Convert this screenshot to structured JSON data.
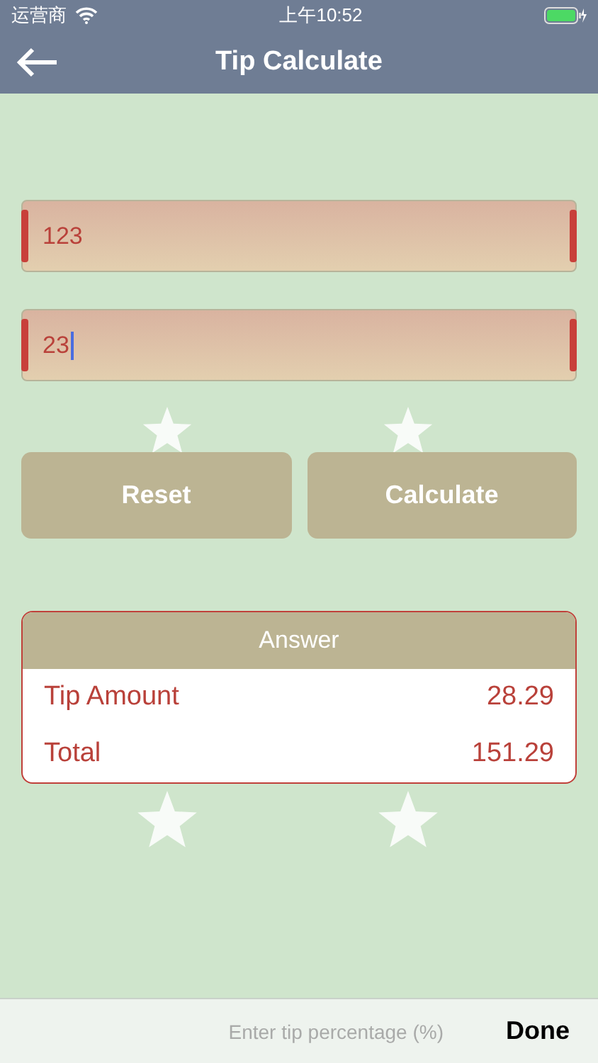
{
  "status_bar": {
    "carrier": "运营商",
    "time": "上午10:52"
  },
  "nav": {
    "title": "Tip Calculate"
  },
  "fields": [
    {
      "value": "123",
      "focused": false
    },
    {
      "value": "23",
      "focused": true
    }
  ],
  "buttons": [
    "Reset",
    "Calculate"
  ],
  "answer": {
    "title": "Answer",
    "rows": [
      {
        "label": "Tip Amount",
        "value": "28.29"
      },
      {
        "label": "Total",
        "value": "151.29"
      }
    ]
  },
  "keyboard_bar": {
    "hint": "Enter tip percentage (%)",
    "done": "Done"
  }
}
